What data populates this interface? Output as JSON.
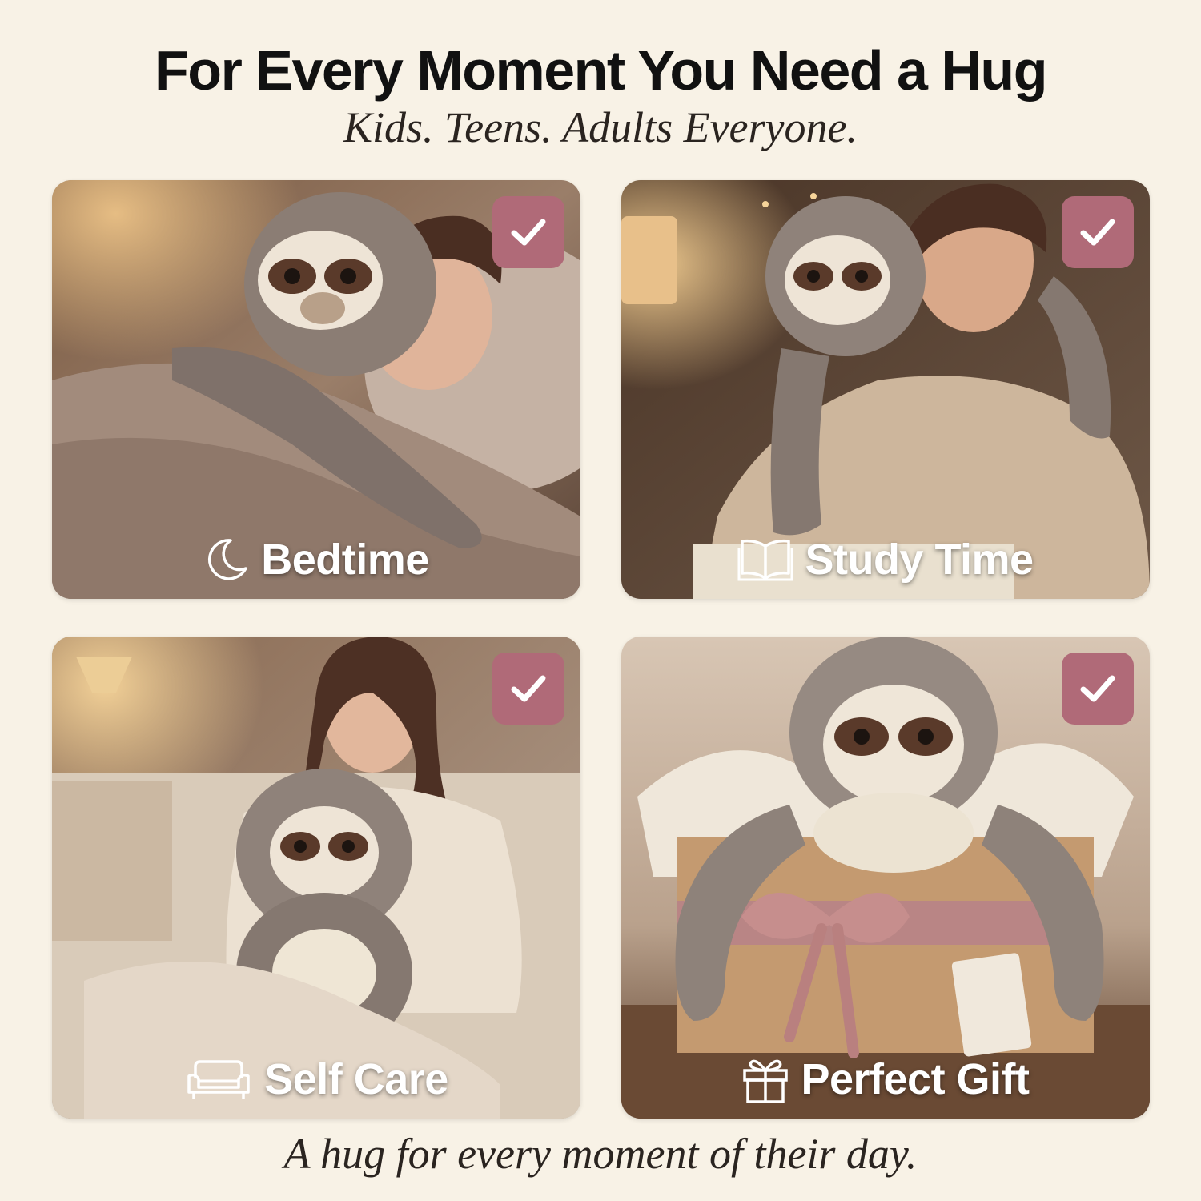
{
  "header": {
    "title": "For Every Moment You Need a Hug",
    "subtitle": "Kids. Teens. Adults Everyone."
  },
  "cards": [
    {
      "label": "Bedtime",
      "icon": "moon-icon",
      "checked": true
    },
    {
      "label": "Study Time",
      "icon": "book-icon",
      "checked": true
    },
    {
      "label": "Self Care",
      "icon": "sofa-icon",
      "checked": true
    },
    {
      "label": "Perfect Gift",
      "icon": "gift-icon",
      "checked": true
    }
  ],
  "footer": {
    "tagline": "A hug for every moment of their day."
  },
  "colors": {
    "background": "#f8f2e6",
    "check_badge": "#b06a78",
    "label_text": "#ffffff"
  }
}
